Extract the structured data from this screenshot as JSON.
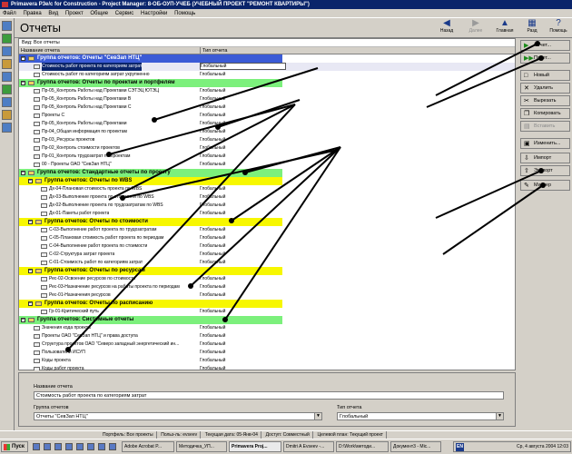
{
  "window": {
    "title": "Primavera P3e/c for Construction - Project Manager: 8-ОБ-ОУП-УЧЕБ (УЧЕБНЫЙ ПРОЕКТ \"РЕМОНТ КВАРТИРЫ\")"
  },
  "menu": [
    "Файл",
    "Правка",
    "Вид",
    "Проект",
    "Общие",
    "Сервис",
    "Настройки",
    "Помощь"
  ],
  "page_title": "Отчеты",
  "nav": {
    "back": "Назад",
    "forward": "Далее",
    "home": "Главная",
    "layout": "Разд",
    "help": "Помощь"
  },
  "filter": "Вид: Все отчеты",
  "columns": {
    "name": "Название отчета",
    "type": "Тип отчета"
  },
  "rows": [
    {
      "kind": "group",
      "level": 0,
      "color": "blue",
      "name": "Группа отчетов: Отчеты \"СевЗап НТЦ\"",
      "type": ""
    },
    {
      "kind": "report",
      "level": 1,
      "name": "Стоимость работ проекта по категориям затрат",
      "type": "Глобальный",
      "selected": true
    },
    {
      "kind": "report",
      "level": 1,
      "name": "Стоимость работ по категориям затрат укрупненно",
      "type": "Глобальный"
    },
    {
      "kind": "group",
      "level": 0,
      "color": "green",
      "name": "Группа отчетов: Отчеты по проектам и портфелям",
      "type": ""
    },
    {
      "kind": "report",
      "level": 1,
      "name": "Пр-05_Контроль Работы над Проектами СЭТЭЦ ЮТЭЦ",
      "type": "Глобальный"
    },
    {
      "kind": "report",
      "level": 1,
      "name": "Пр-05_Контроль Работы над Проектами В",
      "type": "Глобальный"
    },
    {
      "kind": "report",
      "level": 1,
      "name": "Пр-05_Контроль Работы над Проектами С",
      "type": "Глобальный"
    },
    {
      "kind": "report",
      "level": 1,
      "name": "Проекты С",
      "type": "Глобальный"
    },
    {
      "kind": "report",
      "level": 1,
      "name": "Пр-05_Контроль Работы над Проектами",
      "type": "Глобальный"
    },
    {
      "kind": "report",
      "level": 1,
      "name": "Пр-04_Общая информация по проектам",
      "type": "Глобальный"
    },
    {
      "kind": "report",
      "level": 1,
      "name": "Пр-03_Ресурсы проектов",
      "type": "Глобальный"
    },
    {
      "kind": "report",
      "level": 1,
      "name": "Пр-02_Контроль стоимости проектов",
      "type": "Глобальный"
    },
    {
      "kind": "report",
      "level": 1,
      "name": "Пр-01_Контроль трудозатрат по проектам",
      "type": "Глобальный"
    },
    {
      "kind": "report",
      "level": 1,
      "name": "00 - Проекты ОАО \"СевЗап НТЦ\"",
      "type": "Глобальный"
    },
    {
      "kind": "group",
      "level": 0,
      "color": "green",
      "name": "Группа отчетов: Стандартные отчеты по проекту",
      "type": ""
    },
    {
      "kind": "group",
      "level": 1,
      "color": "yellow",
      "name": "Группа отчетов: Отчеты по WBS",
      "type": ""
    },
    {
      "kind": "report",
      "level": 2,
      "name": "Дх-04-Плановая стоимость проекта по WBS",
      "type": "Глобальный"
    },
    {
      "kind": "report",
      "level": 2,
      "name": "Дх-03-Выполнение проекта по стоимости по WBS",
      "type": "Глобальный"
    },
    {
      "kind": "report",
      "level": 2,
      "name": "Дх-02-Выполнение проекта по трудозатратам по WBS",
      "type": "Глобальный"
    },
    {
      "kind": "report",
      "level": 2,
      "name": "Дх-01-Пакеты работ проекта",
      "type": "Глобальный"
    },
    {
      "kind": "group",
      "level": 1,
      "color": "yellow",
      "name": "Группа отчетов: Отчеты по стоимости",
      "type": ""
    },
    {
      "kind": "report",
      "level": 2,
      "name": "С-03-Выполнение работ проекта по трудозатратам",
      "type": "Глобальный"
    },
    {
      "kind": "report",
      "level": 2,
      "name": "С-05-Плановая стоимость работ проекта по периодам",
      "type": "Глобальный"
    },
    {
      "kind": "report",
      "level": 2,
      "name": "С-04-Выполнение работ проекта по стоимости",
      "type": "Глобальный"
    },
    {
      "kind": "report",
      "level": 2,
      "name": "С-02-Структура затрат проекта",
      "type": "Глобальный"
    },
    {
      "kind": "report",
      "level": 2,
      "name": "С-01-Стоимость работ по категориям затрат",
      "type": "Глобальный"
    },
    {
      "kind": "group",
      "level": 1,
      "color": "yellow",
      "name": "Группа отчетов: Отчеты по ресурсам",
      "type": ""
    },
    {
      "kind": "report",
      "level": 2,
      "name": "Рес-02-Освоение ресурсов по стоимости",
      "type": "Глобальный"
    },
    {
      "kind": "report",
      "level": 2,
      "name": "Рес-03-Назначение ресурсов на работы проекта по периодам",
      "type": "Глобальный"
    },
    {
      "kind": "report",
      "level": 2,
      "name": "Рес-01-Назначения ресурсов",
      "type": "Глобальный"
    },
    {
      "kind": "group",
      "level": 1,
      "color": "yellow",
      "name": "Группа отчетов: Отчеты по расписанию",
      "type": ""
    },
    {
      "kind": "report",
      "level": 2,
      "name": "Гр-01-Критический путь",
      "type": "Глобальный"
    },
    {
      "kind": "group",
      "level": 0,
      "color": "green",
      "name": "Группа отчетов: Системные отчеты",
      "type": ""
    },
    {
      "kind": "report",
      "level": 1,
      "name": "Значения кода проекта",
      "type": "Глобальный"
    },
    {
      "kind": "report",
      "level": 1,
      "name": "Проекты ОАО \"СевЗап НТЦ\" и права доступа",
      "type": "Глобальный"
    },
    {
      "kind": "report",
      "level": 1,
      "name": "Структура проектов ОАО \"Северо западный энергетический ин...",
      "type": "Глобальный"
    },
    {
      "kind": "report",
      "level": 1,
      "name": "Пользователи ИСУП",
      "type": "Глобальный"
    },
    {
      "kind": "report",
      "level": 1,
      "name": "Коды проекта",
      "type": "Глобальный"
    },
    {
      "kind": "report",
      "level": 1,
      "name": "Коды работ проекта",
      "type": "Глобальный"
    }
  ],
  "detail": {
    "name_label": "Название отчета",
    "name_value": "Стоимость работ проекта по категориям затрат",
    "group_label": "Группа отчетов",
    "group_value": "Отчеты \"СевЗап НТЦ\"",
    "type_label": "Тип отчета",
    "type_value": "Глобальный"
  },
  "right_buttons": [
    {
      "label": "Отчет...",
      "icon": "play-icon",
      "enabled": true
    },
    {
      "label": "Пакет...",
      "icon": "batch-icon",
      "enabled": true
    },
    {
      "label": "Новый",
      "icon": "new-icon",
      "enabled": true
    },
    {
      "label": "Удалить",
      "icon": "delete-icon",
      "enabled": true
    },
    {
      "label": "Вырезать",
      "icon": "cut-icon",
      "enabled": true
    },
    {
      "label": "Копировать",
      "icon": "copy-icon",
      "enabled": true
    },
    {
      "label": "Вставить",
      "icon": "paste-icon",
      "enabled": false
    },
    {
      "label": "Изменить...",
      "icon": "edit-icon",
      "enabled": true
    },
    {
      "label": "Импорт",
      "icon": "import-icon",
      "enabled": true
    },
    {
      "label": "Экспорт",
      "icon": "export-icon",
      "enabled": true
    },
    {
      "label": "Мастер",
      "icon": "wizard-icon",
      "enabled": true
    }
  ],
  "status": [
    "Портфель: Все проекты",
    "Польз-ль: evseev",
    "Текущая дата: 05-Янв-04",
    "Доступ: Совместный",
    "Целевой план: Текущий проект"
  ],
  "taskbar": {
    "start": "Пуск",
    "tasks": [
      {
        "label": "Adobe Acrobat P...",
        "active": false
      },
      {
        "label": "Методичка_УП...",
        "active": false
      },
      {
        "label": "Primavera Proj...",
        "active": true
      },
      {
        "label": "Dmitri A Evseev -...",
        "active": false
      },
      {
        "label": "D:\\Work\\методи...",
        "active": false
      },
      {
        "label": "Документ3 - Mic...",
        "active": false
      }
    ],
    "lang": "EN",
    "clock": "Ср, 4 августа 2004 12:03"
  },
  "colors": {
    "title_bar": "#0a246a",
    "group_blue": "#3b5bd6",
    "group_green": "#7cf07c",
    "group_yellow": "#f7f700",
    "selection": "#0a246a"
  }
}
